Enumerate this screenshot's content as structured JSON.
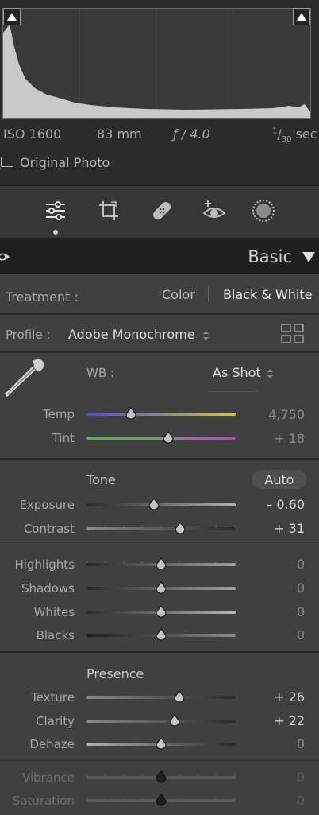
{
  "histogram": {
    "iso": "ISO 1600",
    "focal": "83 mm",
    "aperture": "ƒ / 4.0",
    "shutter": "1/30 sec",
    "shutter_num": "1",
    "shutter_den": "30",
    "shutter_unit": "sec",
    "original_photo": "Original Photo"
  },
  "tools": [
    "edit-sliders-icon",
    "crop-icon",
    "healing-icon",
    "redeye-icon",
    "mask-icon"
  ],
  "basic": {
    "title": "Basic",
    "treatment_label": "Treatment :",
    "treatment_color": "Color",
    "treatment_bw": "Black & White",
    "profile_label": "Profile :",
    "profile_value": "Adobe Monochrome",
    "wb_label": "WB :",
    "wb_value": "As Shot",
    "temp_label": "Temp",
    "temp_value": "4,750",
    "tint_label": "Tint",
    "tint_value": "+ 18",
    "tone_title": "Tone",
    "auto_label": "Auto",
    "exposure_label": "Exposure",
    "exposure_value": "– 0.60",
    "contrast_label": "Contrast",
    "contrast_value": "+ 31",
    "highlights_label": "Highlights",
    "highlights_value": "0",
    "shadows_label": "Shadows",
    "shadows_value": "0",
    "whites_label": "Whites",
    "whites_value": "0",
    "blacks_label": "Blacks",
    "blacks_value": "0",
    "presence_title": "Presence",
    "texture_label": "Texture",
    "texture_value": "+ 26",
    "clarity_label": "Clarity",
    "clarity_value": "+ 22",
    "dehaze_label": "Dehaze",
    "dehaze_value": "0",
    "vibrance_label": "Vibrance",
    "vibrance_value": "0",
    "saturation_label": "Saturation",
    "saturation_value": "0"
  },
  "sliders": {
    "temp": 0.3,
    "tint": 0.55,
    "exposure": 0.45,
    "contrast": 0.63,
    "highlights": 0.5,
    "shadows": 0.5,
    "whites": 0.5,
    "blacks": 0.5,
    "texture": 0.62,
    "clarity": 0.59,
    "dehaze": 0.5,
    "vibrance": 0.5,
    "saturation": 0.5
  },
  "colors": {
    "accent": "#e0e0e0",
    "panel": "#404040",
    "header": "#1f1f1f"
  }
}
